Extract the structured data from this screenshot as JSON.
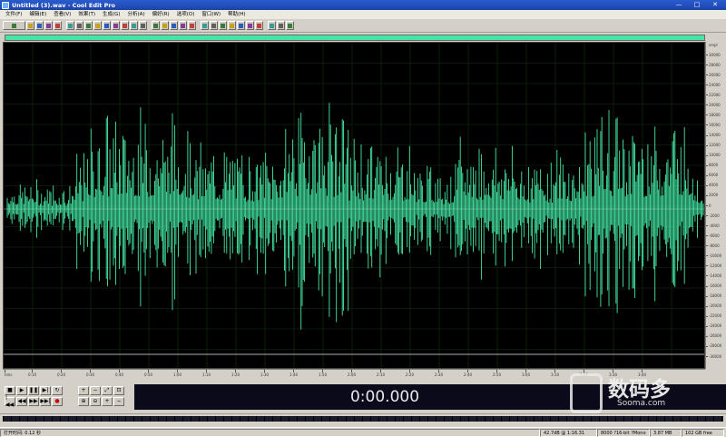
{
  "window": {
    "title": "Untitled (3).wav - Cool Edit Pro",
    "minimize_glyph": "—",
    "maximize_glyph": "□",
    "close_glyph": "✕"
  },
  "menu": [
    "文件(F)",
    "编辑(E)",
    "查看(V)",
    "效果(T)",
    "生成(G)",
    "分析(A)",
    "偏好(R)",
    "选项(O)",
    "窗口(W)",
    "帮助(H)"
  ],
  "toolbar": {
    "groups": [
      [
        "wave-view-icon",
        "open-icon",
        "folder-icon",
        "save-icon",
        "session-icon"
      ],
      [
        "undo-icon",
        "redo-icon",
        "cut-icon",
        "copy-icon",
        "paste-icon",
        "paste-new-icon",
        "mix-paste-icon",
        "trim-icon",
        "silence-icon"
      ],
      [
        "envelope-icon",
        "pitch-icon",
        "noise-icon",
        "spectral-icon",
        "frequency-icon"
      ],
      [
        "marker-icon",
        "loop-icon",
        "cue-icon",
        "info-icon",
        "grid-icon",
        "mono-icon",
        "stereo-icon"
      ],
      [
        "cd-icon",
        "record-settings-icon",
        "help-icon"
      ]
    ],
    "accent_color": "#3ee0a0"
  },
  "waveform": {
    "background": "#000000",
    "wave_color": "#44e8a4",
    "center_line_color": "#e6e6e6"
  },
  "amplitude_ruler": {
    "unit": "smpl",
    "labels": [
      "30000",
      "28000",
      "26000",
      "24000",
      "22000",
      "20000",
      "18000",
      "16000",
      "14000",
      "12000",
      "10000",
      "8000",
      "6000",
      "4000",
      "2000",
      "0",
      "-2000",
      "-4000",
      "-6000",
      "-8000",
      "-10000",
      "-12000",
      "-14000",
      "-16000",
      "-18000",
      "-20000",
      "-22000",
      "-24000",
      "-26000",
      "-28000",
      "-30000"
    ]
  },
  "time_ruler": {
    "labels": [
      "hms",
      "0:10",
      "0:20",
      "0:30",
      "0:40",
      "0:50",
      "1:00",
      "1:10",
      "1:20",
      "1:30",
      "1:40",
      "1:50",
      "2:00",
      "2:10",
      "2:20",
      "2:30",
      "2:40",
      "2:50",
      "3:00",
      "3:10",
      "3:20",
      "3:30",
      "3:40"
    ]
  },
  "transport": {
    "stop": "■",
    "play": "▶",
    "pause": "❚❚",
    "play_to_end": "▶|",
    "loop": "↻",
    "go_start": "|◀◀",
    "rewind": "◀◀",
    "forward": "▶▶",
    "go_end": "▶▶|",
    "record": "●",
    "zoom_in": "+",
    "zoom_out": "−",
    "zoom_full": "⤢",
    "zoom_selection": "⊡",
    "zoom_in_v": "⊕",
    "zoom_out_v": "⊖"
  },
  "time_display": {
    "value": "0:00.000"
  },
  "status": {
    "open_time": "打开时间: 0.12 秒",
    "level": "42.7dB @ 1:16.31",
    "format": "8000 ?16-bit ?Mono",
    "size": "3.87 MB",
    "free": "102 GB free"
  },
  "watermark": {
    "cn": "数码多",
    "en": "Sooma.com"
  }
}
